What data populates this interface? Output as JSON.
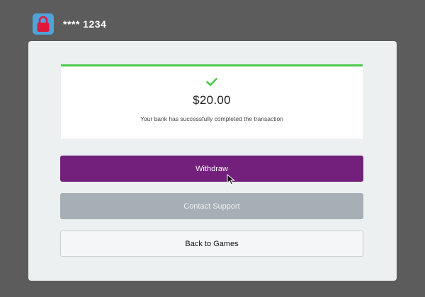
{
  "header": {
    "account_mask": "**** 1234",
    "icon": "lock-icon"
  },
  "success": {
    "icon": "check-icon",
    "amount": "$20.00",
    "message": "Your bank has successfully completed the transaction"
  },
  "actions": {
    "withdraw_label": "Withdraw",
    "support_label": "Contact Support",
    "back_label": "Back to Games"
  },
  "colors": {
    "success_green": "#4cc94c",
    "primary_purple": "#72207c",
    "disabled_gray": "#a6afb5",
    "lock_red": "#e0193a",
    "tile_blue": "#4fa3d9"
  }
}
